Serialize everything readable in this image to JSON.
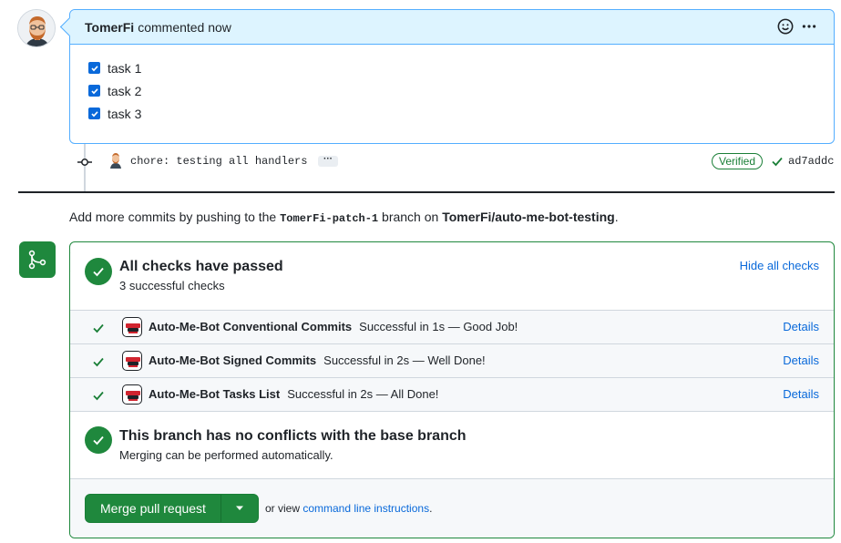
{
  "comment": {
    "author": "TomerFi",
    "meta": "commented now",
    "tasks": [
      {
        "label": "task 1",
        "checked": true
      },
      {
        "label": "task 2",
        "checked": true
      },
      {
        "label": "task 3",
        "checked": true
      }
    ]
  },
  "commit": {
    "message": "chore: testing all handlers",
    "more": "···",
    "verified": "Verified",
    "sha": "ad7addc"
  },
  "push_hint": {
    "prefix": "Add more commits by pushing to the ",
    "branch": "TomerFi-patch-1",
    "middle": " branch on ",
    "repo": "TomerFi/auto-me-bot-testing",
    "suffix": "."
  },
  "checks": {
    "title": "All checks have passed",
    "subtitle": "3 successful checks",
    "hide_label": "Hide all checks",
    "items": [
      {
        "name": "Auto-Me-Bot Conventional Commits",
        "desc": "Successful in 1s — Good Job!",
        "details": "Details"
      },
      {
        "name": "Auto-Me-Bot Signed Commits",
        "desc": "Successful in 2s — Well Done!",
        "details": "Details"
      },
      {
        "name": "Auto-Me-Bot Tasks List",
        "desc": "Successful in 2s — All Done!",
        "details": "Details"
      }
    ]
  },
  "conflicts": {
    "title": "This branch has no conflicts with the base branch",
    "subtitle": "Merging can be performed automatically."
  },
  "merge": {
    "button_label": "Merge pull request",
    "or_view": "or view ",
    "cli_link": "command line instructions",
    "cli_suffix": "."
  },
  "colors": {
    "success": "#1f883d",
    "link": "#0969da",
    "header_bg": "#ddf4ff",
    "header_border": "#54aeff"
  }
}
